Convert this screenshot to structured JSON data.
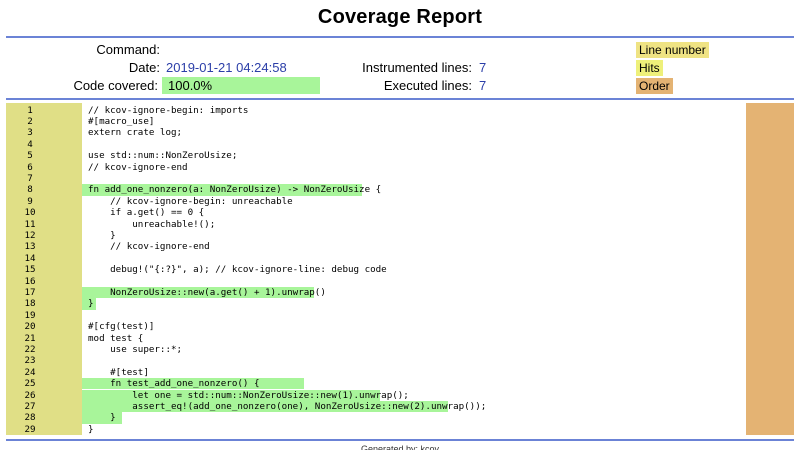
{
  "title": "Coverage Report",
  "meta": {
    "command_label": "Command:",
    "command_value": "",
    "date_label": "Date:",
    "date_value": "2019-01-21 04:24:58",
    "covered_label": "Code covered:",
    "covered_value": "100.0%",
    "instr_label": "Instrumented lines:",
    "instr_value": "7",
    "exec_label": "Executed lines:",
    "exec_value": "7"
  },
  "legend": {
    "line_number": "Line number",
    "hits": "Hits",
    "order": "Order"
  },
  "colors": {
    "accent": "#6b83d6",
    "covered": "#a8f59a",
    "line_col": "#e0df86",
    "order_col": "#e4b373"
  },
  "source": [
    {
      "num": "1",
      "code": "// kcov-ignore-begin: imports",
      "hit": false
    },
    {
      "num": "2",
      "code": "#[macro_use]",
      "hit": false
    },
    {
      "num": "3",
      "code": "extern crate log;",
      "hit": false
    },
    {
      "num": "4",
      "code": "",
      "hit": false
    },
    {
      "num": "5",
      "code": "use std::num::NonZeroUsize;",
      "hit": false
    },
    {
      "num": "6",
      "code": "// kcov-ignore-end",
      "hit": false
    },
    {
      "num": "7",
      "code": "",
      "hit": false
    },
    {
      "num": "8",
      "code": "fn add_one_nonzero(a: NonZeroUsize) -> NonZeroUsize {",
      "hit": true
    },
    {
      "num": "9",
      "code": "    // kcov-ignore-begin: unreachable",
      "hit": false
    },
    {
      "num": "10",
      "code": "    if a.get() == 0 {",
      "hit": false
    },
    {
      "num": "11",
      "code": "        unreachable!();",
      "hit": false
    },
    {
      "num": "12",
      "code": "    }",
      "hit": false
    },
    {
      "num": "13",
      "code": "    // kcov-ignore-end",
      "hit": false
    },
    {
      "num": "14",
      "code": "",
      "hit": false
    },
    {
      "num": "15",
      "code": "    debug!(\"{:?}\", a); // kcov-ignore-line: debug code",
      "hit": false
    },
    {
      "num": "16",
      "code": "",
      "hit": false
    },
    {
      "num": "17",
      "code": "    NonZeroUsize::new(a.get() + 1).unwrap()",
      "hit": true
    },
    {
      "num": "18",
      "code": "}",
      "hit": true
    },
    {
      "num": "19",
      "code": "",
      "hit": false
    },
    {
      "num": "20",
      "code": "#[cfg(test)]",
      "hit": false
    },
    {
      "num": "21",
      "code": "mod test {",
      "hit": false
    },
    {
      "num": "22",
      "code": "    use super::*;",
      "hit": false
    },
    {
      "num": "23",
      "code": "",
      "hit": false
    },
    {
      "num": "24",
      "code": "    #[test]",
      "hit": false
    },
    {
      "num": "25",
      "code": "    fn test_add_one_nonzero() {",
      "hit": true
    },
    {
      "num": "26",
      "code": "        let one = std::num::NonZeroUsize::new(1).unwrap();",
      "hit": true
    },
    {
      "num": "27",
      "code": "        assert_eq!(add_one_nonzero(one), NonZeroUsize::new(2).unwrap());",
      "hit": true
    },
    {
      "num": "28",
      "code": "    }",
      "hit": true
    },
    {
      "num": "29",
      "code": "}",
      "hit": false
    }
  ],
  "footer": "Generated by: kcov"
}
